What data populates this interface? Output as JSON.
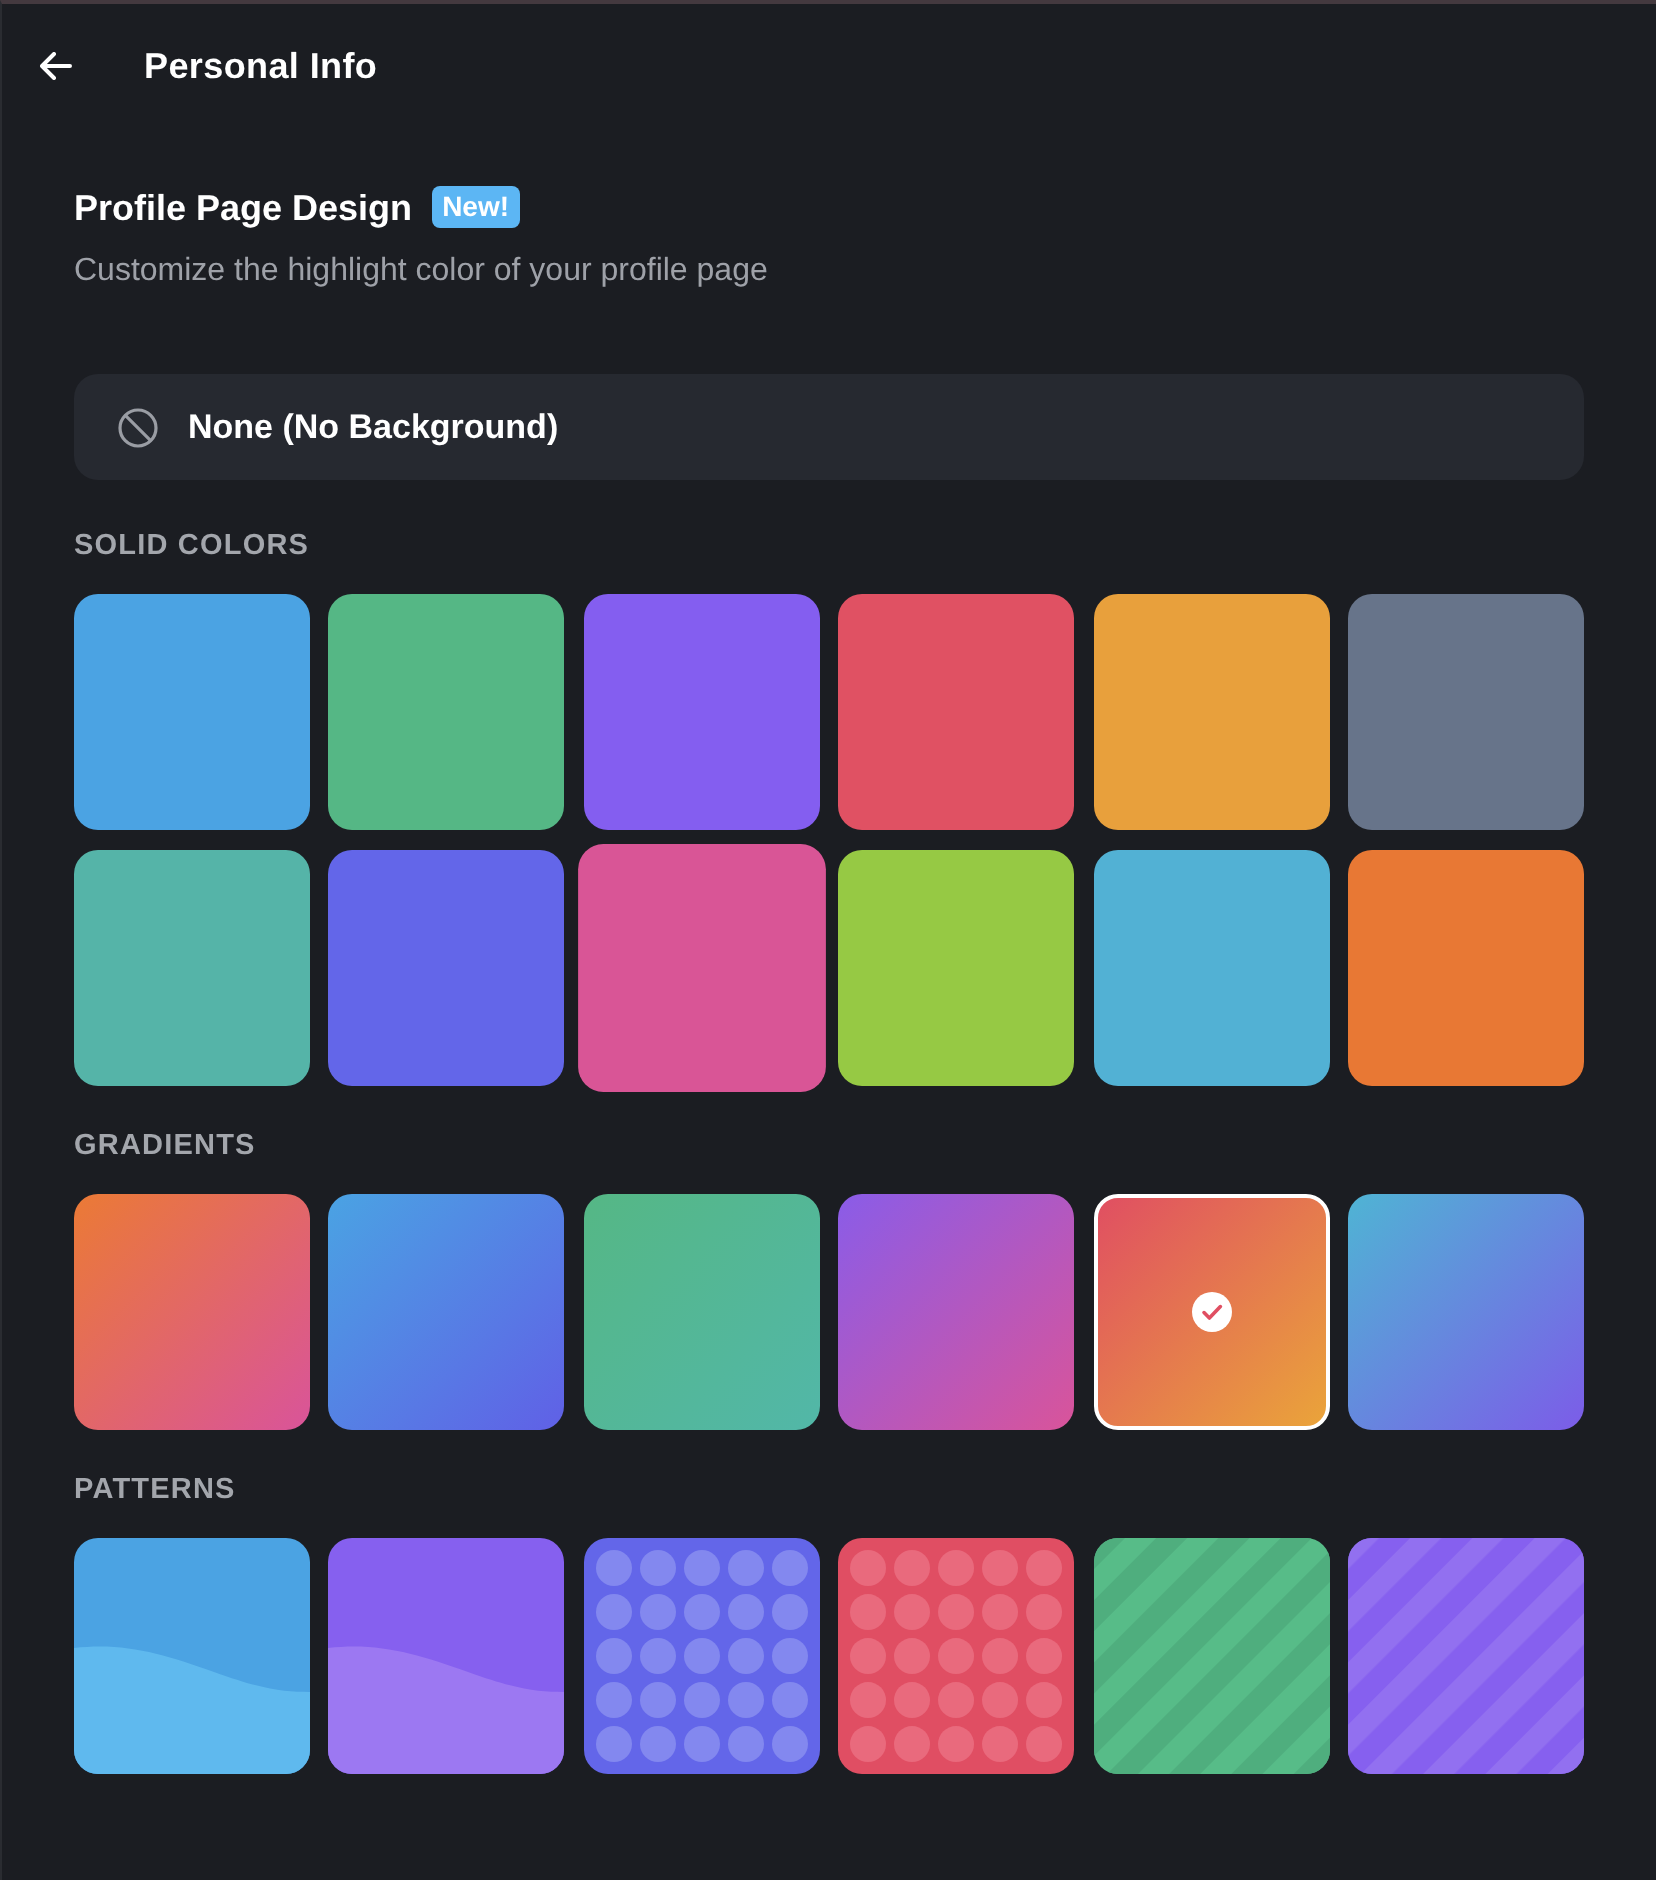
{
  "header": {
    "title": "Personal Info"
  },
  "section": {
    "title": "Profile Page Design",
    "badge": "New!",
    "subtitle": "Customize the highlight color of your profile page"
  },
  "none_option": {
    "label": "None (No Background)",
    "selected": false
  },
  "solid_colors": {
    "label": "SOLID COLORS",
    "swatches": [
      {
        "color": "#4ba3e3",
        "selected": false,
        "hovered": false
      },
      {
        "color": "#55b785",
        "selected": false,
        "hovered": false
      },
      {
        "color": "#845ef0",
        "selected": false,
        "hovered": false
      },
      {
        "color": "#e05163",
        "selected": false,
        "hovered": false
      },
      {
        "color": "#e8a03c",
        "selected": false,
        "hovered": false
      },
      {
        "color": "#67748a",
        "selected": false,
        "hovered": false
      },
      {
        "color": "#55b4a8",
        "selected": false,
        "hovered": false
      },
      {
        "color": "#6366e9",
        "selected": false,
        "hovered": false
      },
      {
        "color": "#d95596",
        "selected": false,
        "hovered": true
      },
      {
        "color": "#96c944",
        "selected": false,
        "hovered": false
      },
      {
        "color": "#52b1d4",
        "selected": false,
        "hovered": false
      },
      {
        "color": "#e87834",
        "selected": false,
        "hovered": false
      }
    ]
  },
  "gradients": {
    "label": "GRADIENTS",
    "swatches": [
      {
        "stops": [
          {
            "color": "#eb7a35"
          },
          {
            "color": "#d9549a"
          }
        ],
        "selected": false
      },
      {
        "stops": [
          {
            "color": "#4aa3e3"
          },
          {
            "color": "#6060e6"
          }
        ],
        "selected": false
      },
      {
        "stops": [
          {
            "color": "#55b785"
          },
          {
            "color": "#52b7a8"
          }
        ],
        "selected": false
      },
      {
        "stops": [
          {
            "color": "#8a5ce8"
          },
          {
            "color": "#d9549a"
          }
        ],
        "selected": false
      },
      {
        "stops": [
          {
            "color": "#e04f62"
          },
          {
            "color": "#eaa43a"
          }
        ],
        "selected": true
      },
      {
        "stops": [
          {
            "color": "#4fb4d4"
          },
          {
            "color": "#7c5ce8"
          }
        ],
        "selected": false
      }
    ]
  },
  "patterns": {
    "label": "PATTERNS",
    "swatches": [
      {
        "kind": "wave",
        "color": "#4ba3e3",
        "accent": {
          "color": "#5fb9ee"
        },
        "selected": false
      },
      {
        "kind": "wave",
        "color": "#8660ef",
        "accent": {
          "color": "#9c78f2"
        },
        "selected": false
      },
      {
        "kind": "dots",
        "color": "#6366e9",
        "accent": {
          "color": "#8388ef"
        },
        "selected": false
      },
      {
        "kind": "dots",
        "color": "#e04e63",
        "accent": {
          "color": "#e96a7d"
        },
        "selected": false
      },
      {
        "kind": "stripes",
        "color": "#57bc88",
        "accent": {
          "color": "#4fae7e"
        },
        "selected": false
      },
      {
        "kind": "stripes",
        "color": "#8660ef",
        "accent": {
          "color": "#9270f0"
        },
        "selected": false
      }
    ]
  }
}
